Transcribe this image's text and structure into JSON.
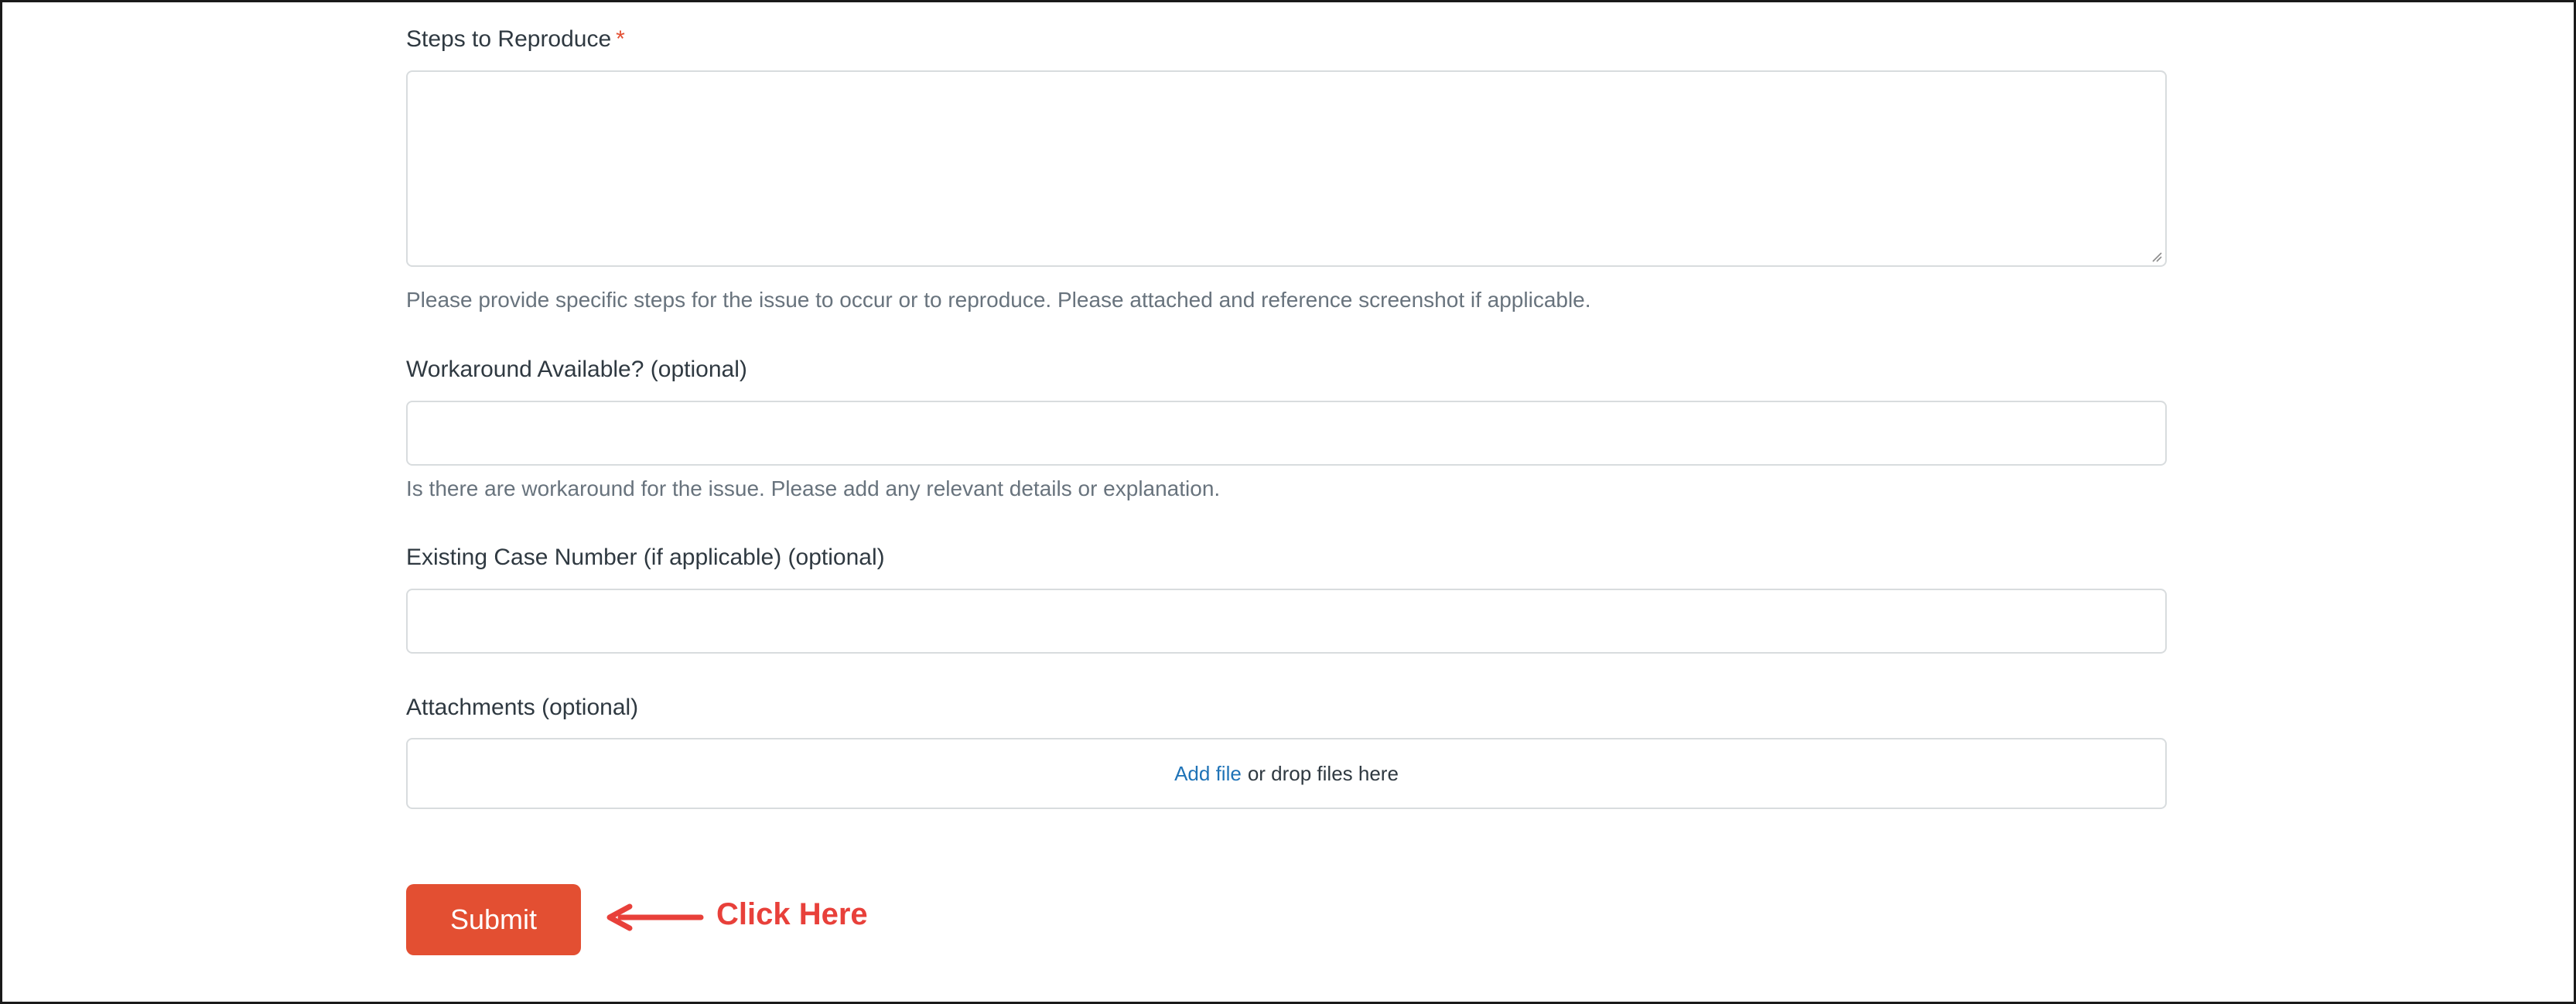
{
  "form": {
    "steps": {
      "label": "Steps to Reproduce",
      "required_mark": "*",
      "value": "",
      "hint": "Please provide specific steps for the issue to occur or to reproduce. Please attached and reference screenshot if applicable."
    },
    "workaround": {
      "label": "Workaround Available?",
      "optional": "(optional)",
      "value": "",
      "hint": "Is there are workaround for the issue. Please add any relevant details or explanation."
    },
    "case_number": {
      "label": "Existing Case Number (if applicable)",
      "optional": "(optional)",
      "value": ""
    },
    "attachments": {
      "label": "Attachments",
      "optional": "(optional)",
      "add_file": "Add file",
      "drop_text": "or drop files here"
    },
    "submit_label": "Submit"
  },
  "annotation": {
    "callout_text": "Click Here",
    "color": "#e8403a"
  },
  "colors": {
    "accent": "#e34f32",
    "link": "#1f73b7",
    "hint": "#68737d",
    "border": "#d8dcde"
  }
}
